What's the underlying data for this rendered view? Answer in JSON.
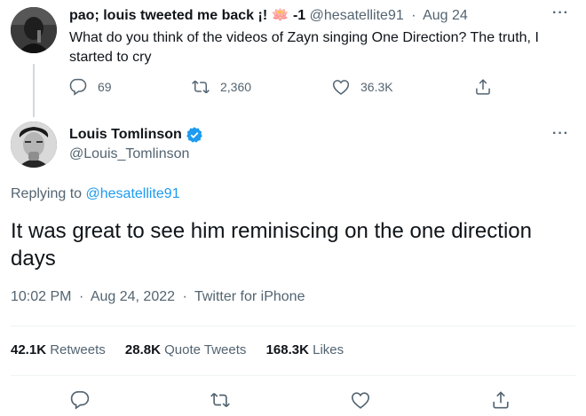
{
  "parent_tweet": {
    "author_name": "pao; louis tweeted me back ¡! 🪷 -1",
    "handle": "@hesatellite91",
    "separator": "·",
    "date": "Aug 24",
    "text": "What do you think of the videos of Zayn singing One Direction? The truth, I started to cry",
    "more_label": "···",
    "reply_count": "69",
    "retweet_count": "2,360",
    "like_count": "36.3K"
  },
  "main_tweet": {
    "author_name": "Louis Tomlinson",
    "handle": "@Louis_Tomlinson",
    "more_label": "···",
    "replying_prefix": "Replying to ",
    "replying_to": "@hesatellite91",
    "text": "It was great to see him reminiscing on the one direction days",
    "time": "10:02 PM",
    "separator": "·",
    "date": "Aug 24, 2022",
    "source": "Twitter for iPhone",
    "retweets": "42.1K",
    "retweets_label": "Retweets",
    "quote_tweets": "28.8K",
    "quote_tweets_label": "Quote Tweets",
    "likes": "168.3K",
    "likes_label": "Likes"
  },
  "icons": {
    "reply": "reply-icon",
    "retweet": "retweet-icon",
    "like": "heart-icon",
    "share": "share-icon",
    "verified": "verified-badge-icon"
  },
  "colors": {
    "accent": "#1d9bf0",
    "text": "#0f1419",
    "muted": "#536471",
    "divider": "#eff3f4"
  }
}
